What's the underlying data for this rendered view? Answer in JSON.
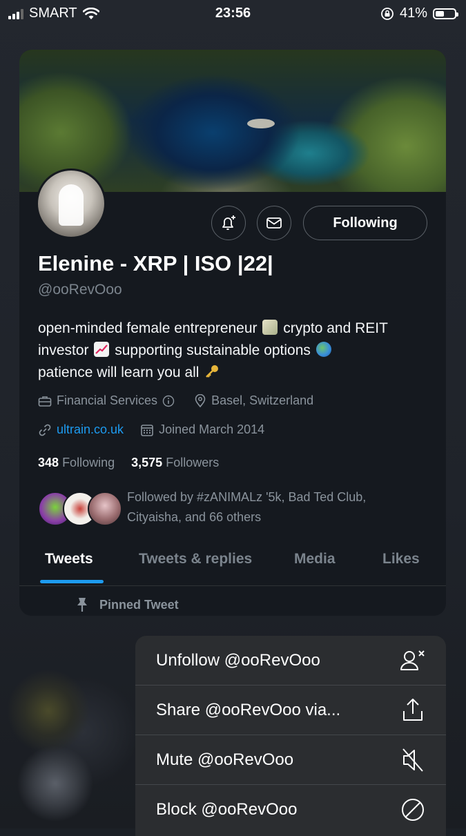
{
  "status_bar": {
    "carrier": "SMART",
    "time": "23:56",
    "battery": "41%"
  },
  "profile": {
    "name": "Elenine - XRP | ISO |22|",
    "handle": "@ooRevOoo",
    "follow_button": "Following",
    "bio_line1": "open-minded female entrepreneur",
    "bio_line1b": "crypto and REIT",
    "bio_line2a": "investor",
    "bio_line2b": "supporting sustainable options",
    "bio_line3": "patience will learn you all",
    "category": "Financial Services",
    "location": "Basel, Switzerland",
    "website": "ultrain.co.uk",
    "joined": "Joined March 2014",
    "following_count": "348",
    "following_label": "Following",
    "followers_count": "3,575",
    "followers_label": "Followers",
    "followed_by_line1": "Followed by #zANIMALz '5k, Bad Ted Club,",
    "followed_by_line2": "Cityaisha, and 66 others"
  },
  "tabs": [
    "Tweets",
    "Tweets & replies",
    "Media",
    "Likes"
  ],
  "active_tab": "Tweets",
  "pinned_label": "Pinned Tweet",
  "menu": {
    "unfollow": "Unfollow @ooRevOoo",
    "share": "Share @ooRevOoo via...",
    "mute": "Mute @ooRevOoo",
    "block": "Block @ooRevOoo"
  },
  "colors": {
    "accent": "#1d9bf0",
    "card_bg": "#15191f",
    "menu_bg": "#2b2d30"
  }
}
